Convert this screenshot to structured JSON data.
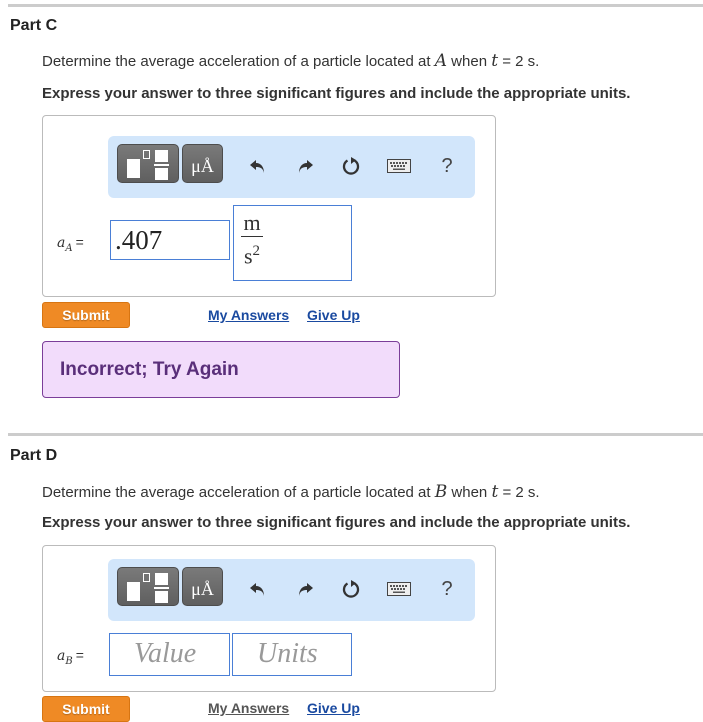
{
  "parts": [
    {
      "title": "Part C",
      "question": {
        "prefix": "Determine the average acceleration of a particle located at ",
        "point": "A",
        "middle": " when ",
        "var": "t",
        "suffix": " = 2 s."
      },
      "instruction": "Express your answer to three significant figures and include the appropriate units.",
      "toolbar": {
        "templates_icon": "templates-icon",
        "units_label": "μÅ",
        "undo_icon": "undo-icon",
        "redo_icon": "redo-icon",
        "reset_icon": "reset-icon",
        "keyboard_icon": "keyboard-icon",
        "help_label": "?"
      },
      "answer_label": {
        "symbol": "a",
        "subscript": "A",
        "equals": "="
      },
      "value": ".407",
      "units": {
        "numerator": "m",
        "denominator": "s",
        "exponent": "2"
      },
      "submit_label": "Submit",
      "my_answers_label": "My Answers",
      "give_up_label": "Give Up",
      "feedback": "Incorrect; Try Again"
    },
    {
      "title": "Part D",
      "question": {
        "prefix": "Determine the average acceleration of a particle located at ",
        "point": "B",
        "middle": " when ",
        "var": "t",
        "suffix": " = 2 s."
      },
      "instruction": "Express your answer to three significant figures and include the appropriate units.",
      "toolbar": {
        "templates_icon": "templates-icon",
        "units_label": "μÅ",
        "undo_icon": "undo-icon",
        "redo_icon": "redo-icon",
        "reset_icon": "reset-icon",
        "keyboard_icon": "keyboard-icon",
        "help_label": "?"
      },
      "answer_label": {
        "symbol": "a",
        "subscript": "B",
        "equals": "="
      },
      "value_placeholder": "Value",
      "units_placeholder": "Units",
      "submit_label": "Submit",
      "my_answers_label": "My Answers",
      "give_up_label": "Give Up"
    }
  ]
}
